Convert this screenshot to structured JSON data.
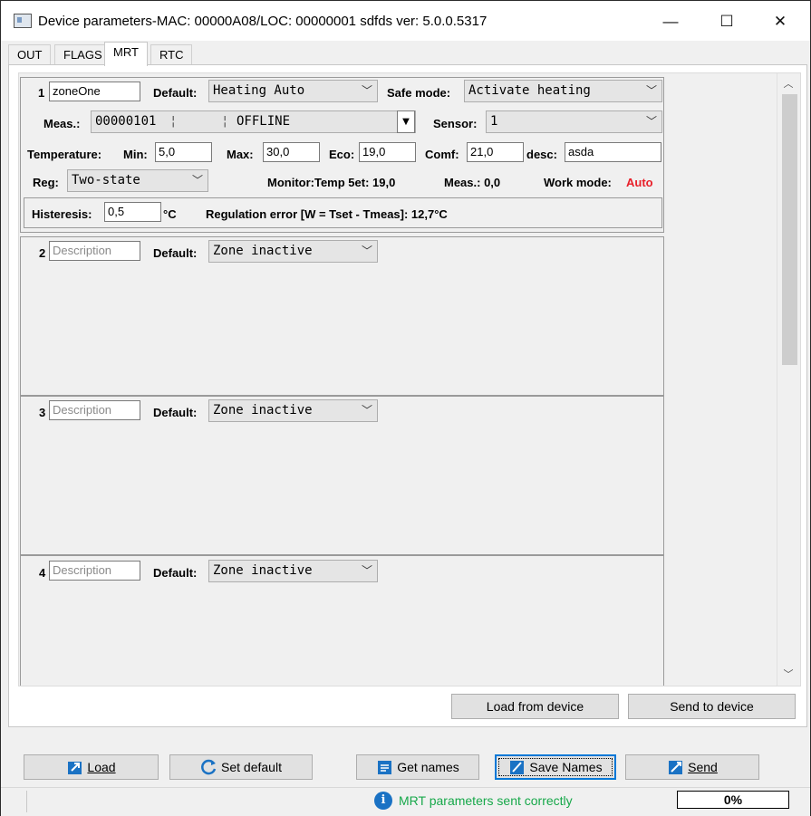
{
  "window": {
    "title": "Device parameters-MAC: 00000A08/LOC: 00000001 sdfds ver: 5.0.0.5317",
    "minimize": "—",
    "maximize": "☐",
    "close": "✕"
  },
  "tabs": [
    "OUT",
    "FLAGS",
    "MRT",
    "RTC"
  ],
  "active_tab": "MRT",
  "zone1": {
    "number": "1",
    "name": "zoneOne",
    "default_label": "Default:",
    "default_value": "Heating Auto",
    "safe_mode_label": "Safe mode:",
    "safe_mode_value": "Activate heating",
    "meas_label": "Meas.:",
    "meas_id": "00000101",
    "meas_status": "OFFLINE",
    "sensor_label": "Sensor:",
    "sensor_value": "1",
    "temperature_label": "Temperature:",
    "min_label": "Min:",
    "min_value": "5,0",
    "max_label": "Max:",
    "max_value": "30,0",
    "eco_label": "Eco:",
    "eco_value": "19,0",
    "comf_label": "Comf:",
    "comf_value": "21,0",
    "desc_label": "desc:",
    "desc_value": "asda",
    "reg_label": "Reg:",
    "reg_value": "Two-state",
    "monitor_text": "Monitor:Temp 5et: 19,0",
    "meas_reading": "Meas.: 0,0",
    "work_mode_label": "Work mode:",
    "work_mode_value": "Auto",
    "histeresis_label": "Histeresis:",
    "histeresis_value": "0,5",
    "histeresis_unit": "°C",
    "regulation_error": "Regulation error [W = Tset - Tmeas]: 12,7°C"
  },
  "zones": [
    {
      "number": "2",
      "placeholder": "Description",
      "default_label": "Default:",
      "default_value": "Zone inactive"
    },
    {
      "number": "3",
      "placeholder": "Description",
      "default_label": "Default:",
      "default_value": "Zone inactive"
    },
    {
      "number": "4",
      "placeholder": "Description",
      "default_label": "Default:",
      "default_value": "Zone inactive"
    }
  ],
  "panel_buttons": {
    "load_from_device": "Load from device",
    "send_to_device": "Send to device"
  },
  "bottom_buttons": {
    "load": "Load",
    "set_default": "Set default",
    "get_names": "Get names",
    "save_names": "Save Names",
    "send": "Send"
  },
  "status": {
    "message": "MRT parameters sent correctly",
    "progress": "0%"
  },
  "colors": {
    "status_green": "#17a84a",
    "work_mode_red": "#e8202a",
    "icon_blue": "#1a72c4"
  }
}
